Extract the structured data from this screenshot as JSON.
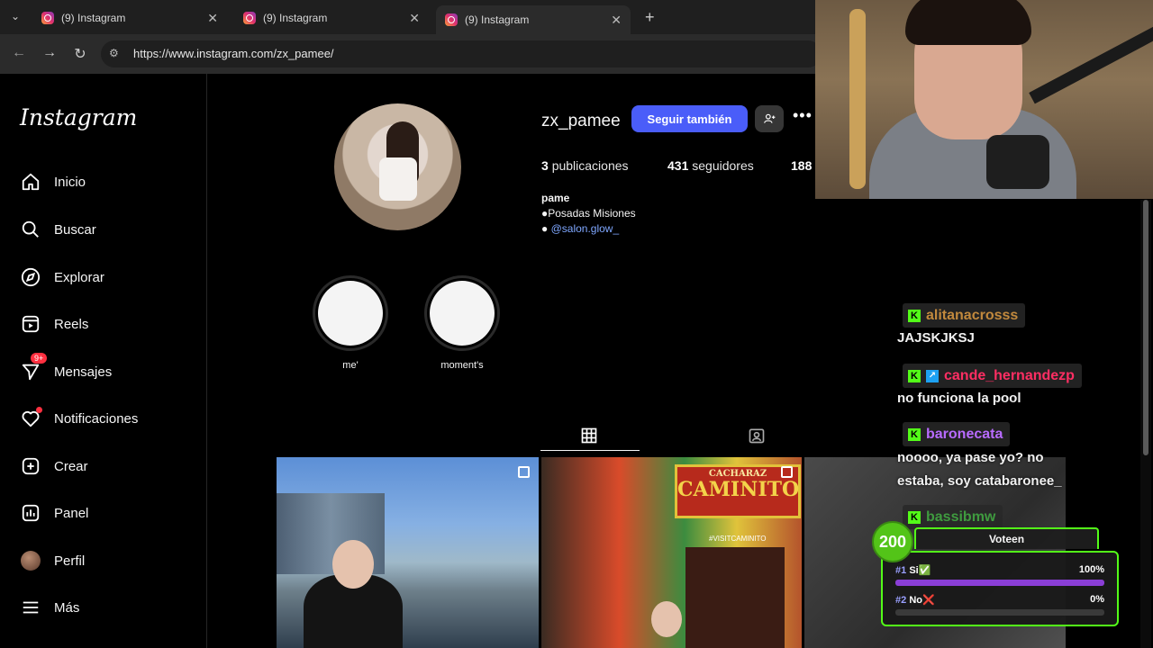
{
  "browser": {
    "tabs": [
      {
        "title": "(9) Instagram",
        "close": "✕"
      },
      {
        "title": "(9) Instagram",
        "close": "✕"
      },
      {
        "title": "(9) Instagram",
        "close": "✕"
      }
    ],
    "new_tab": "+",
    "tab_menu": "⌄",
    "url": "https://www.instagram.com/zx_pamee/"
  },
  "sidebar": {
    "logo": "Instagram",
    "items": [
      {
        "label": "Inicio",
        "icon": "home-icon"
      },
      {
        "label": "Buscar",
        "icon": "search-icon"
      },
      {
        "label": "Explorar",
        "icon": "compass-icon"
      },
      {
        "label": "Reels",
        "icon": "reels-icon"
      },
      {
        "label": "Mensajes",
        "icon": "messenger-icon",
        "badge": "9+"
      },
      {
        "label": "Notificaciones",
        "icon": "heart-icon"
      },
      {
        "label": "Crear",
        "icon": "plus-square-icon"
      },
      {
        "label": "Panel",
        "icon": "chart-icon"
      },
      {
        "label": "Perfil",
        "icon": "avatar"
      },
      {
        "label": "Más",
        "icon": "menu-icon"
      }
    ]
  },
  "profile": {
    "username": "zx_pamee",
    "follow_label": "Seguir también",
    "more": "•••",
    "stats": {
      "posts_count": "3",
      "posts_label": "publicaciones",
      "followers_count": "431",
      "followers_label": "seguidores",
      "following_count": "188"
    },
    "bio_name": "pame",
    "bio_line": "●Posadas Misiones",
    "bio_bullet": "● ",
    "bio_link": "@salon.glow_",
    "highlights": [
      {
        "label": "me'"
      },
      {
        "label": "moment's"
      }
    ]
  },
  "posts": {
    "caminito_sign_top": "CACHARAZ",
    "caminito_sign": "CAMINITO",
    "caminito_sub": "#VISITCAMINITO"
  },
  "chat": [
    {
      "user": "alitanacrosss",
      "color": "#c2893d",
      "message": "JAJSKJKSJ"
    },
    {
      "user": "cande_hernandezp",
      "color": "#ff2e63",
      "message": "no funciona la pool"
    },
    {
      "user": "baronecata",
      "color": "#b86bff",
      "message": "noooo, ya pase yo? no estaba, soy catabaronee_"
    },
    {
      "user": "bassibmw",
      "color": "#3f9b3f",
      "message": ""
    }
  ],
  "poll": {
    "points": "200",
    "title": "Voteen",
    "options": [
      {
        "rank": "#1",
        "label": "Si",
        "mark": "✅",
        "percent": "100%",
        "fraction": 1.0
      },
      {
        "rank": "#2",
        "label": "No",
        "mark": "❌",
        "percent": "0%",
        "fraction": 0.0
      }
    ]
  },
  "colors": {
    "follow_button": "#4a5df9",
    "poll_accent": "#53fc18",
    "poll_bar": "#8a3ed6"
  }
}
